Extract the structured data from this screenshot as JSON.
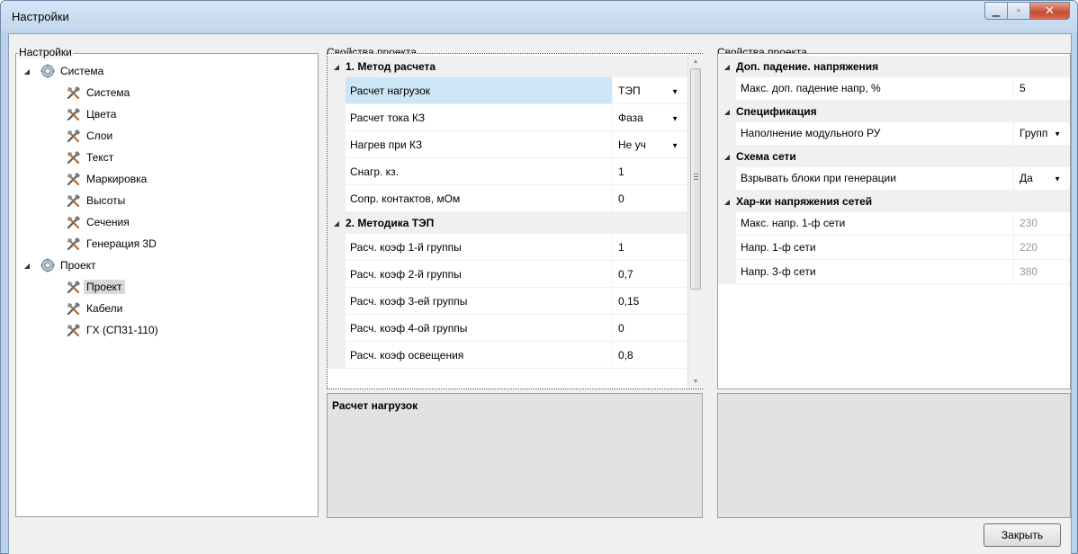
{
  "window": {
    "title": "Настройки"
  },
  "settings_tree": {
    "group_label": "Настройки",
    "nodes": [
      {
        "label": "Система",
        "level": 0
      },
      {
        "label": "Система",
        "level": 1
      },
      {
        "label": "Цвета",
        "level": 1
      },
      {
        "label": "Слои",
        "level": 1
      },
      {
        "label": "Текст",
        "level": 1
      },
      {
        "label": "Маркировка",
        "level": 1
      },
      {
        "label": "Высоты",
        "level": 1
      },
      {
        "label": "Сечения",
        "level": 1
      },
      {
        "label": "Генерация 3D",
        "level": 1
      },
      {
        "label": "Проект",
        "level": 0
      },
      {
        "label": "Проект",
        "level": 1,
        "selected": true
      },
      {
        "label": "Кабели",
        "level": 1
      },
      {
        "label": "ГХ (СП31-110)",
        "level": 1
      }
    ]
  },
  "middle_panel": {
    "group_label": "Свойства проекта",
    "categories": [
      {
        "title": "1. Метод расчета",
        "rows": [
          {
            "name": "Расчет нагрузок",
            "value": "ТЭП",
            "dropdown": true,
            "selected": true
          },
          {
            "name": "Расчет тока КЗ",
            "value": "Фаза",
            "dropdown": true
          },
          {
            "name": "Нагрев при КЗ",
            "value": "Не уч",
            "dropdown": true
          },
          {
            "name": "Снагр. кз.",
            "value": "1"
          },
          {
            "name": "Сопр. контактов, мОм",
            "value": "0"
          }
        ]
      },
      {
        "title": "2. Методика ТЭП",
        "rows": [
          {
            "name": "Расч. коэф 1-й группы",
            "value": "1"
          },
          {
            "name": "Расч. коэф 2-й группы",
            "value": "0,7"
          },
          {
            "name": "Расч. коэф 3-ей группы",
            "value": "0,15"
          },
          {
            "name": "Расч. коэф 4-ой группы",
            "value": "0"
          },
          {
            "name": "Расч. коэф освещения",
            "value": "0,8"
          }
        ]
      }
    ],
    "help_title": "Расчет нагрузок"
  },
  "right_panel": {
    "group_label": "Свойства проекта",
    "categories": [
      {
        "title": "Доп. падение. напряжения",
        "rows": [
          {
            "name": "Макс. доп. падение напр, %",
            "value": "5"
          }
        ]
      },
      {
        "title": "Спецификация",
        "rows": [
          {
            "name": "Наполнение модульного РУ",
            "value": "Групп",
            "dropdown": true
          }
        ]
      },
      {
        "title": "Схема сети",
        "rows": [
          {
            "name": "Взрывать блоки при генерации",
            "value": "Да",
            "dropdown": true
          }
        ]
      },
      {
        "title": "Хар-ки напряжения сетей",
        "rows": [
          {
            "name": "Макс. напр. 1-ф сети",
            "value": "230",
            "readonly": true
          },
          {
            "name": "Напр. 1-ф сети",
            "value": "220",
            "readonly": true
          },
          {
            "name": "Напр. 3-ф сети",
            "value": "380",
            "readonly": true
          }
        ]
      }
    ]
  },
  "footer": {
    "close_label": "Закрыть"
  },
  "colors": {
    "selection": "#cde6f7",
    "category_bg": "#f0f0f0",
    "window_frame": "#b9d1ea"
  }
}
